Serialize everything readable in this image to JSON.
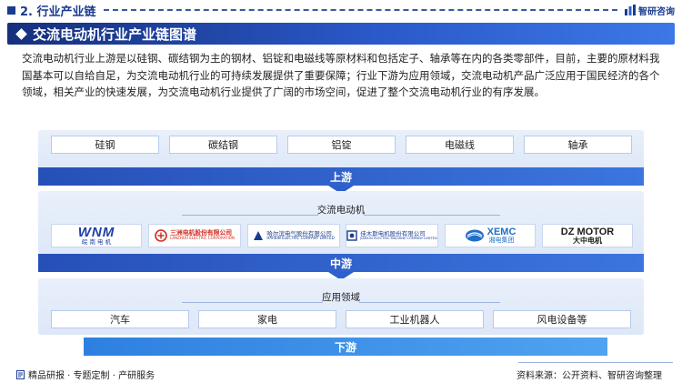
{
  "header": {
    "section_title": "2. 行业产业链",
    "brand": "智研咨询"
  },
  "banner": {
    "title": "交流电动机行业产业链图谱"
  },
  "intro": "交流电动机行业上游是以硅钢、碳结钢为主的钢材、铝锭和电磁线等原材料和包括定子、轴承等在内的各类零部件，目前，主要的原材料我国基本可以自给自足，为交流电动机行业的可持续发展提供了重要保障；行业下游为应用领域，交流电动机产品广泛应用于国民经济的各个领域，相关产业的快速发展，为交流电动机行业提供了广阔的市场空间，促进了整个交流电动机行业的有序发展。",
  "upstream": {
    "items": [
      "硅钢",
      "碳结钢",
      "铝锭",
      "电磁线",
      "轴承"
    ],
    "band_label": "上游"
  },
  "midstream": {
    "label": "交流电动机",
    "companies": [
      {
        "main": "WNM",
        "sub": "皖 南 电 机",
        "color": "#1f3fa8"
      },
      {
        "main": "三洲电机股份有限公司",
        "sub": "LANZHOU ELECTRIC CORPORATION",
        "color": "#d12a1f"
      },
      {
        "main": "哈尔滨电气股份有限公司",
        "sub": "HARBIN ELECTRIC COMPANY LIMITED",
        "color": "#1a3b8f"
      },
      {
        "main": "佳木斯电机股份有限公司",
        "sub": "JIAMUSI ELECTRIC MACHINE COMPANY LIMITED",
        "color": "#1a3b8f"
      },
      {
        "main": "XEMC",
        "sub": "湘电集团",
        "color": "#1f6fc8"
      },
      {
        "main": "DZ MOTOR",
        "sub": "大中电机",
        "color": "#1a1a1a"
      }
    ],
    "band_label": "中游"
  },
  "downstream": {
    "label": "应用领域",
    "items": [
      "汽车",
      "家电",
      "工业机器人",
      "风电设备等"
    ],
    "band_label": "下游"
  },
  "footer": {
    "left": "精品研报 · 专题定制 · 产研服务",
    "source": "资料来源：公开资料、智研咨询整理"
  },
  "colors": {
    "primary": "#1a3b8f",
    "accent": "#2d5fcd",
    "light_bg": "#e4ecf9"
  }
}
